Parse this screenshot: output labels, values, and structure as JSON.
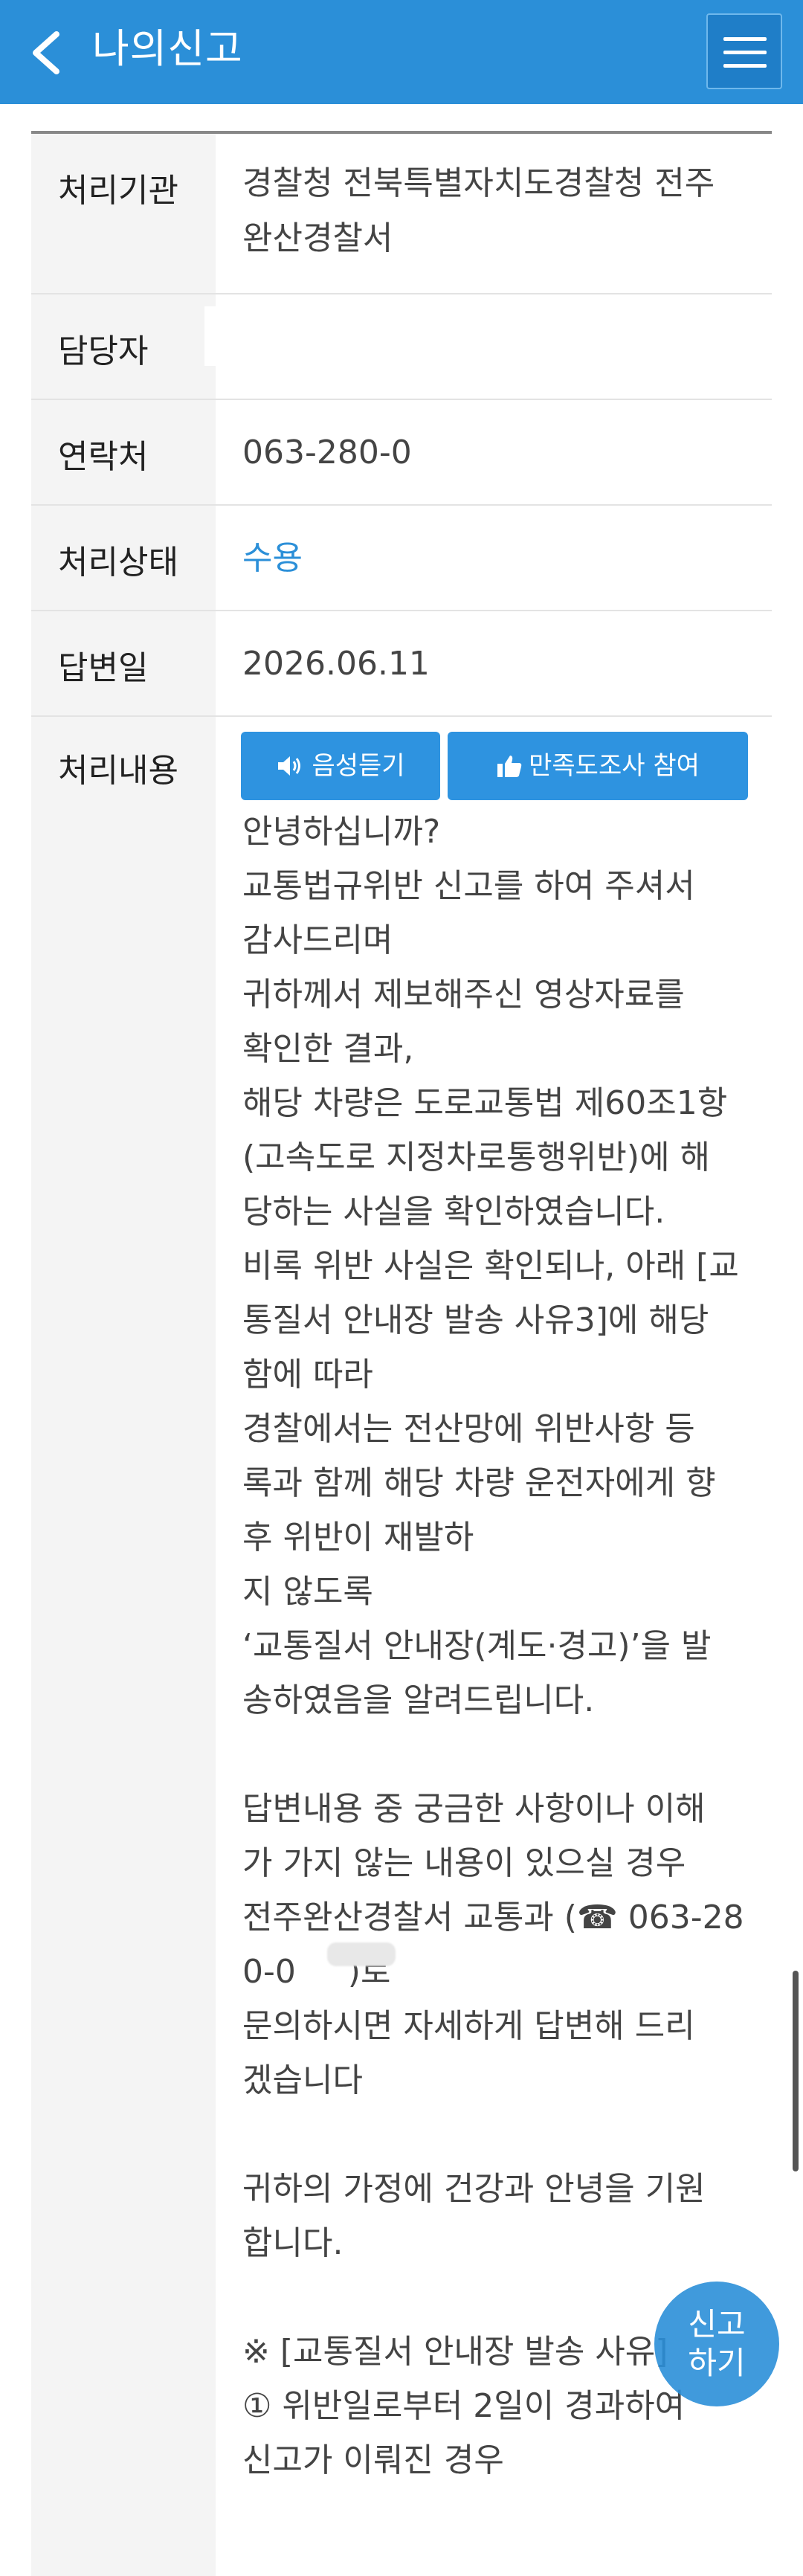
{
  "header": {
    "title": "나의신고"
  },
  "details": {
    "rows": [
      {
        "label": "처리기관",
        "value_line1": "경찰청 전북특별자치도경찰청 전주",
        "value_line2": "완산경찰서"
      },
      {
        "label": "담당자",
        "value": ""
      },
      {
        "label": "연락처",
        "value": "063-280-0"
      },
      {
        "label": "처리상태",
        "value": "수용"
      },
      {
        "label": "답변일",
        "value": "2026.06.11"
      },
      {
        "label": "처리내용"
      }
    ]
  },
  "actions": {
    "listen_label": "음성듣기",
    "survey_label": "만족도조사 참여"
  },
  "response": {
    "lines": [
      "안녕하십니까?",
      "교통법규위반 신고를 하여 주셔서",
      "감사드리며",
      "귀하께서 제보해주신 영상자료를",
      "확인한 결과,",
      "해당 차량은 도로교통법 제60조1항",
      "(고속도로 지정차로통행위반)에 해",
      "당하는 사실을 확인하였습니다.",
      "비록 위반 사실은 확인되나, 아래 [교",
      "통질서 안내장 발송 사유3]에 해당",
      "함에 따라",
      "경찰에서는 전산망에 위반사항 등",
      "록과 함께 해당 차량 운전자에게 향",
      "후 위반이 재발하",
      "지 않도록",
      "‘교통질서 안내장(계도·경고)’을 발",
      "송하였음을 알려드립니다.",
      "",
      "답변내용 중 궁금한 사항이나 이해",
      "가 가지 않는 내용이 있으실 경우",
      "전주완산경찰서 교통과 (☎ 063-28",
      "0-0     )로",
      "문의하시면 자세하게 답변해 드리",
      "겠습니다",
      "",
      "귀하의 가정에 건강과 안녕을 기원",
      "합니다.",
      "",
      "※ [교통질서 안내장 발송 사유]",
      "① 위반일로부터 2일이 경과하여",
      "신고가 이뤄진 경우"
    ]
  },
  "fab": {
    "line1": "신고",
    "line2": "하기"
  },
  "colors": {
    "header": "#2b8fd8",
    "button": "#2e93e0",
    "status": "#2b8fd8"
  }
}
